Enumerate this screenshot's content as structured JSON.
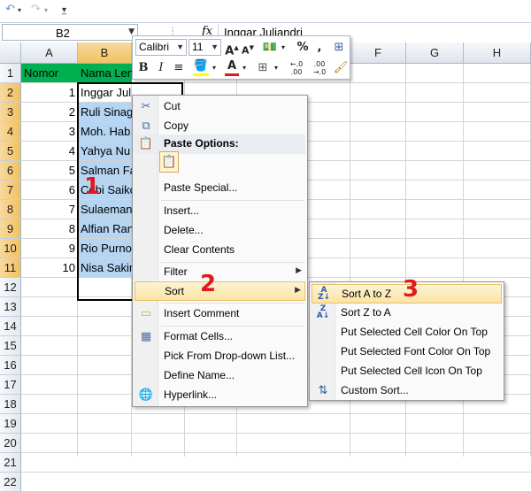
{
  "qat": {
    "undo_icon": "undo-icon",
    "redo_icon": "redo-icon",
    "customize_icon": "customize-qat-icon"
  },
  "formula_bar": {
    "name_box": "B2",
    "fx": "fx",
    "content": "Inggar Juliandri"
  },
  "columns": [
    "A",
    "B",
    "C",
    "D",
    "E",
    "F",
    "G",
    "H"
  ],
  "rows": [
    "1",
    "2",
    "3",
    "4",
    "5",
    "6",
    "7",
    "8",
    "9",
    "10",
    "11",
    "12",
    "13",
    "14",
    "15",
    "16",
    "17",
    "18",
    "19",
    "20",
    "21",
    "22"
  ],
  "cells": {
    "A1": "Nomor",
    "B1": "Nama Len",
    "numbers": [
      "1",
      "2",
      "3",
      "4",
      "5",
      "6",
      "7",
      "8",
      "9",
      "10"
    ],
    "names": [
      "Inggar Juliandri",
      "Ruli Sinag",
      "Moh. Hab",
      "Yahya Nu",
      "Salman Fa",
      "Cebi Saiko",
      "Sulaeman",
      "Alfian Ran",
      "Rio Purno",
      "Nisa Sakin"
    ]
  },
  "mini_toolbar": {
    "font": "Calibri",
    "size": "11",
    "grow_font": "A",
    "shrink_font": "A",
    "percent": "%",
    "comma": ",",
    "bold": "B",
    "italic": "I",
    "align": "≡",
    "font_color": "A",
    "inc_decimal": ".0 .00",
    "dec_decimal": ".00 .0"
  },
  "context_menu": {
    "cut": "Cut",
    "copy": "Copy",
    "paste_options": "Paste Options:",
    "paste_special": "Paste Special...",
    "insert": "Insert...",
    "delete": "Delete...",
    "clear_contents": "Clear Contents",
    "filter": "Filter",
    "sort": "Sort",
    "insert_comment": "Insert Comment",
    "format_cells": "Format Cells...",
    "pick_from_list": "Pick From Drop-down List...",
    "define_name": "Define Name...",
    "hyperlink": "Hyperlink..."
  },
  "sort_submenu": {
    "sort_a_z": "Sort A to Z",
    "sort_z_a": "Sort Z to A",
    "cell_color": "Put Selected Cell Color On Top",
    "font_color": "Put Selected Font Color On Top",
    "cell_icon": "Put Selected Cell Icon On Top",
    "custom_sort": "Custom Sort..."
  },
  "markers": {
    "m1": "1",
    "m2": "2",
    "m3": "3"
  },
  "colors": {
    "header_green": "#00b050",
    "selection_blue": "#b5d5f3",
    "marker_red": "#e0191e",
    "hot_item": "#fbe3a4"
  }
}
